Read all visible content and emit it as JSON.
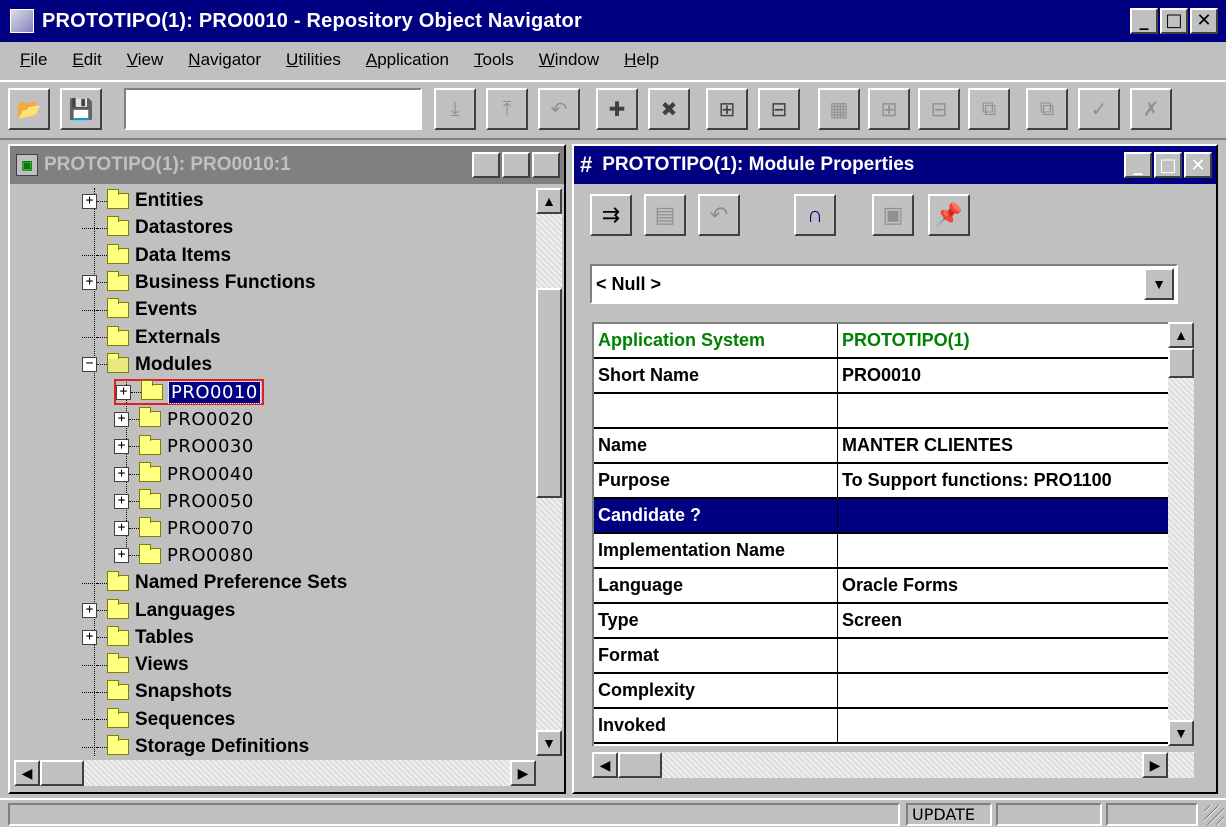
{
  "window": {
    "title": "PROTOTIPO(1): PRO0010 - Repository Object Navigator",
    "buttons": {
      "minimize": "_",
      "maximize": "□",
      "close": "✕"
    }
  },
  "menu": [
    {
      "label": "File"
    },
    {
      "label": "Edit"
    },
    {
      "label": "View"
    },
    {
      "label": "Navigator"
    },
    {
      "label": "Utilities"
    },
    {
      "label": "Application"
    },
    {
      "label": "Tools"
    },
    {
      "label": "Window"
    },
    {
      "label": "Help"
    }
  ],
  "toolbar": {
    "input_value": "",
    "buttons": [
      {
        "icon": "open-folder-icon",
        "glyph": "📂"
      },
      {
        "icon": "save-icon",
        "glyph": "💾"
      },
      {
        "icon": "expand-icon",
        "glyph": "⤓"
      },
      {
        "icon": "collapse-icon",
        "glyph": "⤒"
      },
      {
        "icon": "undo-icon",
        "glyph": "↶"
      },
      {
        "icon": "create-icon",
        "glyph": "✚"
      },
      {
        "icon": "delete-icon",
        "glyph": "✖"
      },
      {
        "icon": "property-icon",
        "glyph": "⊞"
      },
      {
        "icon": "property-palette-icon",
        "glyph": "⊟"
      },
      {
        "icon": "matrix-icon",
        "glyph": "▦"
      },
      {
        "icon": "expand-all-icon",
        "glyph": "⊞"
      },
      {
        "icon": "collapse-all-icon",
        "glyph": "⊟"
      },
      {
        "icon": "copy-icon",
        "glyph": "⧉"
      },
      {
        "icon": "paste-icon",
        "glyph": "⧉"
      },
      {
        "icon": "mark-icon",
        "glyph": "✓"
      },
      {
        "icon": "unmark-icon",
        "glyph": "✗"
      },
      {
        "icon": "share-icon",
        "glyph": "⇱"
      }
    ]
  },
  "navigator": {
    "title": "PROTOTIPO(1): PRO0010:1",
    "tree": [
      {
        "label": "Entities",
        "kind": "cat",
        "expandable": true
      },
      {
        "label": "Datastores",
        "kind": "cat",
        "expandable": false
      },
      {
        "label": "Data Items",
        "kind": "cat",
        "expandable": false
      },
      {
        "label": "Business Functions",
        "kind": "cat",
        "expandable": true
      },
      {
        "label": "Events",
        "kind": "cat",
        "expandable": false
      },
      {
        "label": "Externals",
        "kind": "cat",
        "expandable": false
      },
      {
        "label": "Modules",
        "kind": "cat",
        "expandable": true,
        "expanded": true
      },
      {
        "label": "PRO0010",
        "kind": "mod",
        "expandable": true,
        "selected": true
      },
      {
        "label": "PRO0020",
        "kind": "mod",
        "expandable": true
      },
      {
        "label": "PRO0030",
        "kind": "mod",
        "expandable": true
      },
      {
        "label": "PRO0040",
        "kind": "mod",
        "expandable": true
      },
      {
        "label": "PRO0050",
        "kind": "mod",
        "expandable": true
      },
      {
        "label": "PRO0070",
        "kind": "mod",
        "expandable": true
      },
      {
        "label": "PRO0080",
        "kind": "mod",
        "expandable": true
      },
      {
        "label": "Named Preference Sets",
        "kind": "cat",
        "expandable": false
      },
      {
        "label": "Languages",
        "kind": "cat",
        "expandable": true
      },
      {
        "label": "Tables",
        "kind": "cat",
        "expandable": true
      },
      {
        "label": "Views",
        "kind": "cat",
        "expandable": false
      },
      {
        "label": "Snapshots",
        "kind": "cat",
        "expandable": false
      },
      {
        "label": "Sequences",
        "kind": "cat",
        "expandable": false
      },
      {
        "label": "Storage Definitions",
        "kind": "cat",
        "expandable": false
      }
    ]
  },
  "properties": {
    "title": "PROTOTIPO(1): Module Properties",
    "selector_value": "< Null >",
    "rows": [
      {
        "name": "Application System",
        "value": "PROTOTIPO(1)",
        "style": "green"
      },
      {
        "name": "Short Name",
        "value": "PRO0010",
        "style": ""
      },
      {
        "name": "",
        "value": "",
        "style": ""
      },
      {
        "name": "Name",
        "value": "MANTER CLIENTES",
        "style": ""
      },
      {
        "name": "Purpose",
        "value": "To Support functions: PRO1100",
        "style": ""
      },
      {
        "name": "Candidate ?",
        "value": "",
        "style": "hl"
      },
      {
        "name": "Implementation Name",
        "value": "",
        "style": ""
      },
      {
        "name": "Language",
        "value": "Oracle Forms",
        "style": ""
      },
      {
        "name": "Type",
        "value": "Screen",
        "style": ""
      },
      {
        "name": "Format",
        "value": "",
        "style": ""
      },
      {
        "name": "Complexity",
        "value": "",
        "style": ""
      },
      {
        "name": "Invoked",
        "value": "",
        "style": ""
      }
    ]
  },
  "status": {
    "mode": "UPDATE"
  },
  "colors": {
    "title_active": "#000080",
    "title_inactive": "#808080",
    "face": "#c0c0c0",
    "green_text": "#008000",
    "selection_border": "#e02020"
  }
}
